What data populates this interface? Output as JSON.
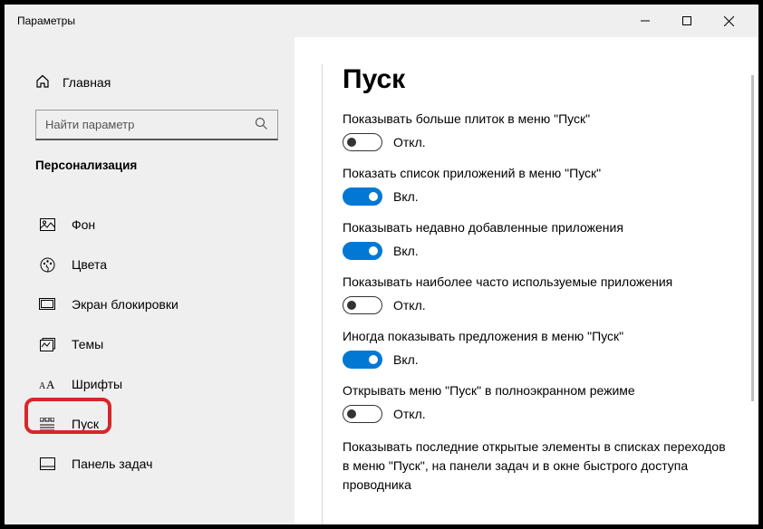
{
  "window": {
    "title": "Параметры"
  },
  "sidebar": {
    "home_label": "Главная",
    "search_placeholder": "Найти параметр",
    "section_title": "Персонализация",
    "items": [
      {
        "label": "Фон"
      },
      {
        "label": "Цвета"
      },
      {
        "label": "Экран блокировки"
      },
      {
        "label": "Темы"
      },
      {
        "label": "Шрифты"
      },
      {
        "label": "Пуск"
      },
      {
        "label": "Панель задач"
      }
    ]
  },
  "page": {
    "heading": "Пуск",
    "state_on": "Вкл.",
    "state_off": "Откл.",
    "settings": [
      {
        "label": "Показывать больше плиток в меню \"Пуск\"",
        "on": false
      },
      {
        "label": "Показать список приложений в меню \"Пуск\"",
        "on": true
      },
      {
        "label": "Показывать недавно добавленные приложения",
        "on": true
      },
      {
        "label": "Показывать наиболее часто используемые приложения",
        "on": false
      },
      {
        "label": "Иногда показывать предложения в меню \"Пуск\"",
        "on": true
      },
      {
        "label": "Открывать меню \"Пуск\" в полноэкранном режиме",
        "on": false
      }
    ],
    "last_label": "Показывать последние открытые элементы в списках переходов в меню \"Пуск\", на панели задач и в окне быстрого доступа проводника"
  }
}
